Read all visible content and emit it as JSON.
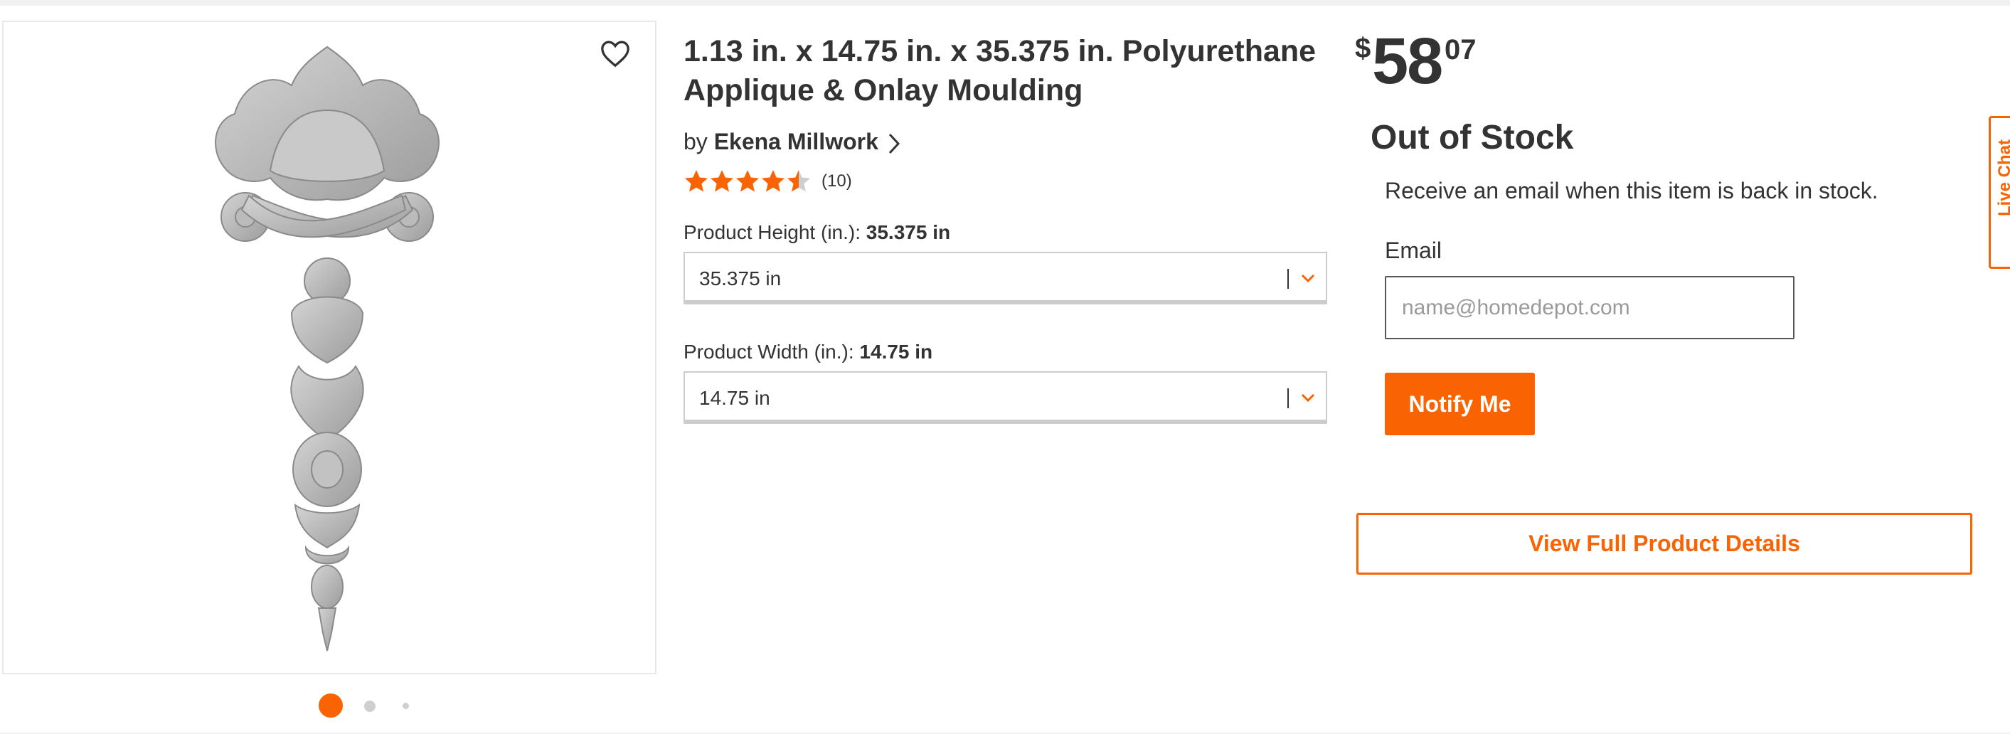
{
  "product": {
    "title": "1.13 in. x 14.75 in. x 35.375 in. Polyurethane Applique & Onlay Moulding",
    "by_label": "by",
    "brand": "Ekena Millwork",
    "rating": {
      "value": 4.5,
      "max": 5,
      "count_text": "(10)"
    }
  },
  "options": {
    "height": {
      "label": "Product Height (in.):",
      "selected": "35.375 in",
      "select_value": "35.375 in"
    },
    "width": {
      "label": "Product Width (in.):",
      "selected": "14.75 in",
      "select_value": "14.75 in"
    }
  },
  "price": {
    "currency": "$",
    "whole": "58",
    "cents": "07"
  },
  "stock": {
    "status": "Out of Stock",
    "message": "Receive an email when this item is back in stock.",
    "email_label": "Email",
    "email_placeholder": "name@homedepot.com",
    "email_value": "",
    "notify_button": "Notify Me"
  },
  "actions": {
    "view_details": "View Full Product Details"
  },
  "gallery": {
    "image_count": 3,
    "active_index": 0,
    "favorite_icon": "heart-outline-icon"
  },
  "live_chat": {
    "label": "Live Chat",
    "icon": "chat-bubble-icon"
  },
  "colors": {
    "accent": "#f96302",
    "text": "#333333",
    "border": "#cccccc",
    "star": "#f96302"
  }
}
